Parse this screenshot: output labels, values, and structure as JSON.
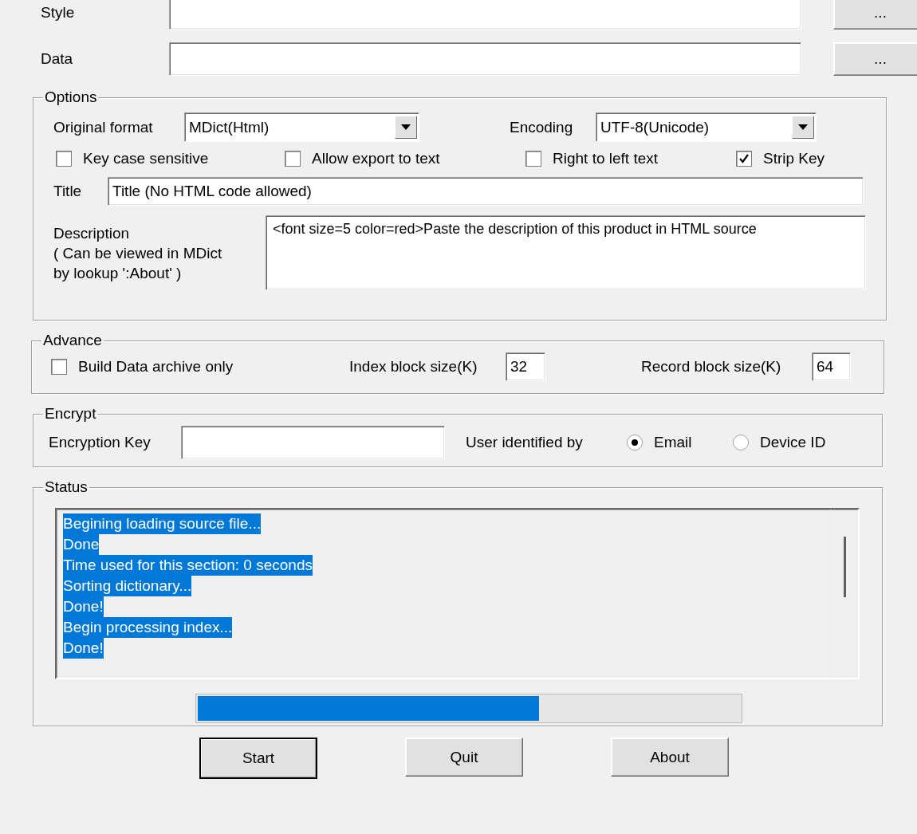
{
  "top_fields": [
    {
      "label": "Style",
      "button": "..."
    },
    {
      "label": "Data",
      "button": "..."
    }
  ],
  "options": {
    "title": "Options",
    "original_format": {
      "label": "Original format",
      "value": "MDict(Html)"
    },
    "encoding": {
      "label": "Encoding",
      "value": "UTF-8(Unicode)"
    },
    "checkboxes": [
      {
        "label": "Key case sensitive",
        "checked": false
      },
      {
        "label": "Allow export to text",
        "checked": false
      },
      {
        "label": "Right to left text",
        "checked": false
      },
      {
        "label": "Strip Key",
        "checked": true
      }
    ],
    "title_field": {
      "label": "Title",
      "value": "Title (No HTML code allowed)"
    },
    "description": {
      "label": "Description\n( Can be viewed in MDict\nby lookup ':About' )",
      "value": "<font size=5 color=red>Paste the description of this product in HTML source"
    }
  },
  "advance": {
    "title": "Advance",
    "checkbox": {
      "label": "Build Data archive only",
      "checked": false
    },
    "index_block": {
      "label": "Index block size(K)",
      "value": "32"
    },
    "record_block": {
      "label": "Record block size(K)",
      "value": "64"
    }
  },
  "encrypt": {
    "title": "Encrypt",
    "key_label": "Encryption Key",
    "user_label": "User identified by",
    "options": [
      {
        "label": "Email",
        "selected": true
      },
      {
        "label": "Device ID",
        "selected": false
      }
    ]
  },
  "status": {
    "title": "Status",
    "lines": [
      {
        "text": "Begining loading source file...",
        "selected": true
      },
      {
        "text": "Done",
        "selected": true
      },
      {
        "text": "Time used for this section: 0 seconds",
        "selected": true
      },
      {
        "text": "Sorting dictionary...",
        "selected": true
      },
      {
        "text": "Done!",
        "selected": true
      },
      {
        "text": "Begin processing index...",
        "selected": true
      },
      {
        "text": "Done!",
        "selected": true
      }
    ],
    "progress": {
      "level": 0.63
    }
  },
  "buttons": [
    {
      "label": "Start",
      "default": true
    },
    {
      "label": "Quit",
      "default": false
    },
    {
      "label": "About",
      "default": false
    }
  ]
}
